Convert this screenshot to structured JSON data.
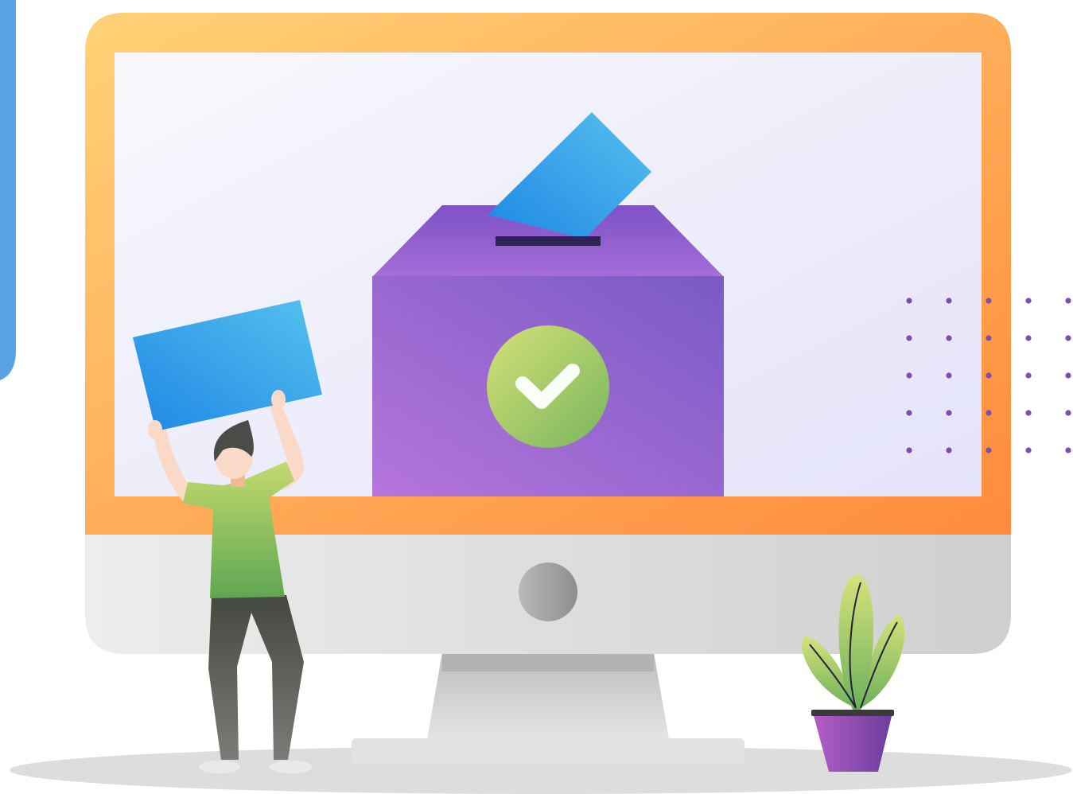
{
  "illustration": {
    "subject": "online-voting",
    "colors": {
      "monitor_frame_start": "#FFD276",
      "monitor_frame_end": "#FF8A3D",
      "screen_start": "#F8F8FC",
      "screen_end": "#E4E3FA",
      "monitor_chin": "#DCDCDC",
      "stand": "#C8C8C8",
      "ballot_box_start": "#B575DC",
      "ballot_box_end": "#7A5AC4",
      "ballot_paper_start": "#1E88E5",
      "ballot_paper_end": "#56C1EE",
      "check_badge_start": "#D4E078",
      "check_badge_end": "#79B65C",
      "dot_pattern": "#7B4FB0",
      "shirt": "#8CC25E",
      "pants": "#585A55",
      "plant_pot": "#9A4FC4",
      "plant_leaves": "#8BBF58",
      "ground_shadow": "#DDDDDD",
      "side_bar": "#5AA3E3"
    },
    "icons": [
      "check-icon",
      "ballot-box-icon",
      "ballot-paper-icon",
      "monitor-icon",
      "person-icon",
      "plant-icon"
    ]
  }
}
